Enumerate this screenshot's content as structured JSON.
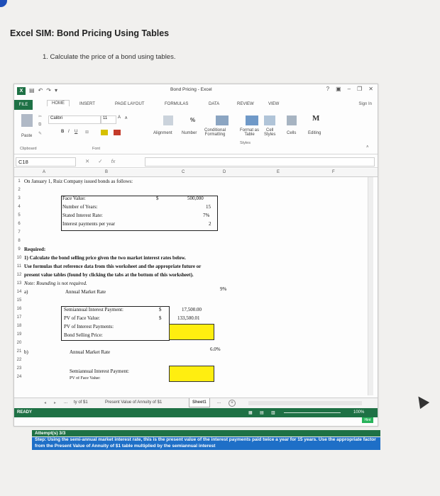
{
  "page": {
    "title": "Excel SIM: Bond Pricing Using Tables",
    "question": "1. Calculate the price of a bond using tables."
  },
  "window": {
    "title": "Bond Pricing - Excel",
    "controls": [
      "?",
      "▣",
      "–",
      "❐",
      "✕"
    ],
    "signin": "Sign In"
  },
  "ribbon": {
    "tabs": [
      "FILE",
      "HOME",
      "INSERT",
      "PAGE LAYOUT",
      "FORMULAS",
      "DATA",
      "REVIEW",
      "VIEW"
    ],
    "paste": "Paste",
    "font_name": "Calibri",
    "font_size": "11",
    "font_grow": "A",
    "font_shrink": "A",
    "bold": "B",
    "italic": "I",
    "underline": "U",
    "alignment": "Alignment",
    "number": "Number",
    "percent": "%",
    "conditional": "Conditional\nFormatting",
    "format_table": "Format as\nTable",
    "cell_styles": "Cell\nStyles",
    "cells": "Cells",
    "editing": "Editing",
    "groups": [
      "Clipboard",
      "Font",
      "Styles"
    ]
  },
  "formula_bar": {
    "name_box": "C18",
    "cancel": "✕",
    "enter": "✓",
    "fx": "fx"
  },
  "columns": [
    "A",
    "B",
    "C",
    "D",
    "E",
    "F"
  ],
  "sheet": {
    "row1": "On January 1, Ruiz Company issued bonds as follows:",
    "face_value_label": "Face Value:",
    "face_value_currency": "$",
    "face_value": "500,000",
    "years_label": "Number of Years:",
    "years": "15",
    "rate_label": "Stated Interest Rate:",
    "rate": "7%",
    "payments_label": "Interest payments per year",
    "payments": "2",
    "required": "Required:",
    "req1": "1) Calculate the bond selling price given the two market interest rates below.",
    "req2": "Use formulas that reference data from this worksheet and the appropriate future or",
    "req3": "present value tables (found by clicking the tabs at the bottom of this worksheet).",
    "note": "Note: Rounding is not required.",
    "a_label": "a)",
    "a_market": "Annual Market Rate",
    "a_rate": "9%",
    "a_semi_label": "Semiannual Interest Payment:",
    "a_semi_currency": "$",
    "a_semi": "17,500.00",
    "a_pvface_label": "PV of Face Value:",
    "a_pvface_currency": "$",
    "a_pvface": "133,500.01",
    "a_pvint_label": "PV of Interest Payments:",
    "a_price_label": "Bond Selling Price:",
    "b_label": "b)",
    "b_market": "Annual Market Rate",
    "b_rate": "6.0%",
    "b_semi_label": "Semiannual Interest Payment:",
    "b_pvface_label": "PV of Face Value:"
  },
  "rows": [
    "1",
    "2",
    "3",
    "4",
    "5",
    "6",
    "7",
    "8",
    "9",
    "10",
    "11",
    "12",
    "13",
    "14",
    "15",
    "16",
    "17",
    "18",
    "19",
    "20",
    "21",
    "22",
    "23",
    "24"
  ],
  "sheet_tabs": {
    "prev": "...",
    "tab_fv": "ty of $1",
    "tab_pva": "Present Value of Annuity of $1",
    "active": "Sheet1",
    "more": "...",
    "add": "+"
  },
  "status": {
    "ready": "READY",
    "zoom": "100%",
    "hint": "Hint"
  },
  "attempt": "Attempt(s)   3/3",
  "step": "Step: Using the semi-annual market interest rate, this is the present value of the interest payments paid twice a year for 15 years. Use the appropriate factor from the Present Value of Annuity of $1 table multiplied by the semiannual interest"
}
